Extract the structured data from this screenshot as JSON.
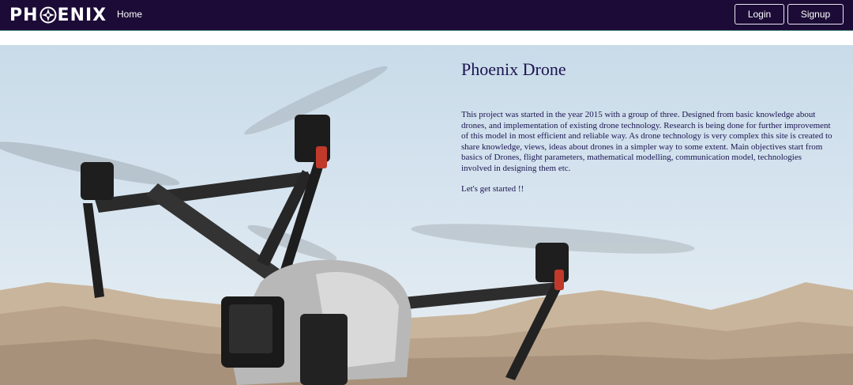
{
  "navbar": {
    "logo_text_left": "PH",
    "logo_text_right": "ENIX",
    "home_label": "Home",
    "login_label": "Login",
    "signup_label": "Signup"
  },
  "hero": {
    "title": "Phoenix Drone",
    "description": "This project was started in the year 2015 with a group of three. Designed from basic knowledge about drones, and implementation of existing drone technology. Research is being done for further improvement of this model in most efficient and reliable way. As drone technology is very complex this site is created to share knowledge, views, ideas about drones in a simpler way to some extent. Main objectives start from basics of Drones, flight parameters, mathematical modelling, communication model, technologies involved in designing them etc.",
    "cta": "Let's get started !!"
  },
  "colors": {
    "navbar_bg": "#1b0b36",
    "text_primary": "#1b1450"
  },
  "icons": {
    "logo_mark": "phoenix-emblem-icon"
  }
}
